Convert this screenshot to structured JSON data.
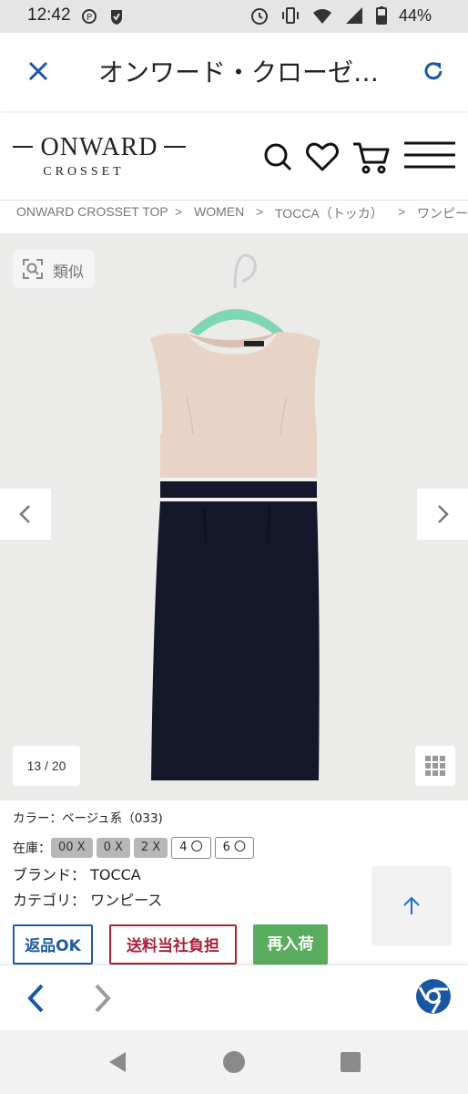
{
  "status_bar": {
    "time": "12:42",
    "battery": "44%"
  },
  "browser": {
    "title": "オンワード・クローゼ…",
    "close_icon": "close-icon",
    "reload_icon": "reload-icon"
  },
  "site": {
    "logo_main": "ONWARD",
    "logo_sub": "CROSSET"
  },
  "breadcrumb": {
    "items": [
      "ONWARD CROSSET TOP",
      "WOMEN",
      "TOCCA（トッカ）",
      "ワンピース"
    ],
    "separator": ">"
  },
  "gallery": {
    "similar_label": "類似",
    "counter": "13 / 20"
  },
  "product": {
    "color_line": "カラー：ベージュ系（033)",
    "stock_label": "在庫：",
    "sizes": [
      {
        "label": "00 X",
        "available": false
      },
      {
        "label": "0 X",
        "available": false
      },
      {
        "label": "2 X",
        "available": false
      },
      {
        "label": "4 〇",
        "available": true
      },
      {
        "label": "6 〇",
        "available": true
      }
    ],
    "brand_line": "ブランド： TOCCA",
    "category_line": "カテゴリ： ワンピース"
  },
  "badges": {
    "return": "返品OK",
    "shipping": "送料当社負担",
    "restock": "再入荷"
  },
  "colors": {
    "brand_blue": "#1a56a6",
    "return_blue": "#1e5aa8",
    "shipping_red": "#a8233a",
    "restock_green": "#5aad5e",
    "dress_beige": "#e8d3c7",
    "dress_navy": "#15182a",
    "hanger_mint": "#7fd6b4"
  }
}
